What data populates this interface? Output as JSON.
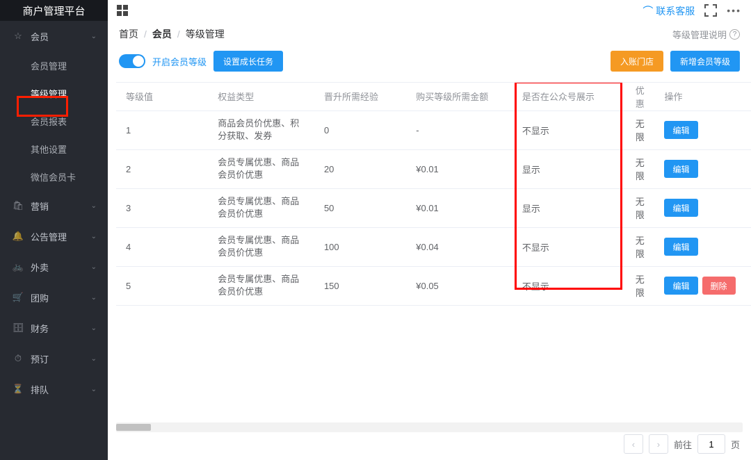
{
  "brand": "商户管理平台",
  "top_actions": {
    "contact": "联系客服"
  },
  "sidebar": {
    "groups": [
      {
        "icon": "☆",
        "label": "会员",
        "open": true,
        "subs": [
          "会员管理",
          "等级管理",
          "会员报表",
          "其他设置",
          "微信会员卡"
        ],
        "active_sub": "等级管理"
      },
      {
        "icon": "🛍",
        "label": "营销"
      },
      {
        "icon": "🔔",
        "label": "公告管理"
      },
      {
        "icon": "🚲",
        "label": "外卖"
      },
      {
        "icon": "🛒",
        "label": "团购"
      },
      {
        "icon": "🗄",
        "label": "财务"
      },
      {
        "icon": "⏱",
        "label": "预订"
      },
      {
        "icon": "⏳",
        "label": "排队"
      }
    ]
  },
  "breadcrumb": {
    "home": "首页",
    "lvl1": "会员",
    "lvl2": "等级管理",
    "note": "等级管理说明"
  },
  "toolbar": {
    "switch_label": "开启会员等级",
    "task_btn": "设置成长任务",
    "store_btn": "入账门店",
    "add_btn": "新增会员等级"
  },
  "table": {
    "headers": [
      "等级值",
      "权益类型",
      "晋升所需经验",
      "购买等级所需金额",
      "是否在公众号展示",
      "优惠",
      "操作"
    ],
    "rows": [
      {
        "level": "1",
        "rights": "商品会员价优惠、积分获取、发券",
        "exp": "0",
        "amount": "-",
        "show": "不显示",
        "disc": "无限",
        "ops": [
          "编辑"
        ]
      },
      {
        "level": "2",
        "rights": "会员专属优惠、商品会员价优惠",
        "exp": "20",
        "amount": "¥0.01",
        "show": "显示",
        "disc": "无限",
        "ops": [
          "编辑"
        ]
      },
      {
        "level": "3",
        "rights": "会员专属优惠、商品会员价优惠",
        "exp": "50",
        "amount": "¥0.01",
        "show": "显示",
        "disc": "无限",
        "ops": [
          "编辑"
        ]
      },
      {
        "level": "4",
        "rights": "会员专属优惠、商品会员价优惠",
        "exp": "100",
        "amount": "¥0.04",
        "show": "不显示",
        "disc": "无限",
        "ops": [
          "编辑"
        ]
      },
      {
        "level": "5",
        "rights": "会员专属优惠、商品会员价优惠",
        "exp": "150",
        "amount": "¥0.05",
        "show": "不显示",
        "disc": "无限",
        "ops": [
          "编辑",
          "删除"
        ]
      }
    ]
  },
  "pager": {
    "goto": "前往",
    "page": "1",
    "unit": "页"
  }
}
